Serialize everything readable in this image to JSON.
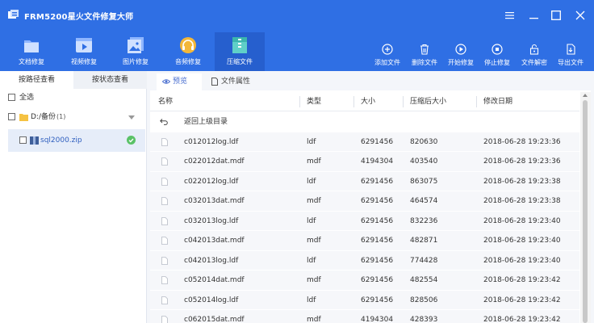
{
  "app": {
    "title": "FRM5200星火文件修复大师"
  },
  "toolbar_left": [
    {
      "label": "文档修复",
      "icon": "document-repair-icon"
    },
    {
      "label": "视频修复",
      "icon": "video-repair-icon"
    },
    {
      "label": "图片修复",
      "icon": "image-repair-icon"
    },
    {
      "label": "音频修复",
      "icon": "audio-repair-icon"
    },
    {
      "label": "压缩文件",
      "icon": "archive-icon"
    }
  ],
  "toolbar_right": [
    {
      "label": "添加文件",
      "icon": "add-file-icon"
    },
    {
      "label": "删除文件",
      "icon": "delete-file-icon"
    },
    {
      "label": "开始修复",
      "icon": "start-repair-icon"
    },
    {
      "label": "停止修复",
      "icon": "stop-repair-icon"
    },
    {
      "label": "文件解密",
      "icon": "decrypt-icon"
    },
    {
      "label": "导出文件",
      "icon": "export-icon"
    }
  ],
  "left_panel": {
    "tabs": [
      "按路径查看",
      "按状态查看"
    ],
    "select_all": "全选",
    "drive": {
      "label": "D:/备份",
      "count": "(1)"
    },
    "file": "sql2000.zip"
  },
  "right_panel": {
    "tabs": [
      "预览",
      "文件属性"
    ],
    "columns": [
      "名称",
      "类型",
      "大小",
      "压缩后大小",
      "修改日期"
    ],
    "back_label": "返回上级目录",
    "rows": [
      {
        "name": "c012012log.ldf",
        "type": "ldf",
        "size": "6291456",
        "compressed": "820630",
        "date": "2018-06-28 19:23:36"
      },
      {
        "name": "c022012dat.mdf",
        "type": "mdf",
        "size": "4194304",
        "compressed": "403540",
        "date": "2018-06-28 19:23:36"
      },
      {
        "name": "c022012log.ldf",
        "type": "ldf",
        "size": "6291456",
        "compressed": "863075",
        "date": "2018-06-28 19:23:38"
      },
      {
        "name": "c032013dat.mdf",
        "type": "mdf",
        "size": "6291456",
        "compressed": "464574",
        "date": "2018-06-28 19:23:38"
      },
      {
        "name": "c032013log.ldf",
        "type": "ldf",
        "size": "6291456",
        "compressed": "832236",
        "date": "2018-06-28 19:23:40"
      },
      {
        "name": "c042013dat.mdf",
        "type": "mdf",
        "size": "6291456",
        "compressed": "482871",
        "date": "2018-06-28 19:23:40"
      },
      {
        "name": "c042013log.ldf",
        "type": "ldf",
        "size": "6291456",
        "compressed": "774428",
        "date": "2018-06-28 19:23:40"
      },
      {
        "name": "c052014dat.mdf",
        "type": "mdf",
        "size": "6291456",
        "compressed": "482554",
        "date": "2018-06-28 19:23:42"
      },
      {
        "name": "c052014log.ldf",
        "type": "ldf",
        "size": "6291456",
        "compressed": "828506",
        "date": "2018-06-28 19:23:42"
      },
      {
        "name": "c062015dat.mdf",
        "type": "mdf",
        "size": "4194304",
        "compressed": "428393",
        "date": "2018-06-28 19:23:42"
      }
    ]
  },
  "colors": {
    "primary": "#2f6fe4",
    "accent": "#4a6fd0",
    "success": "#5ac267"
  }
}
